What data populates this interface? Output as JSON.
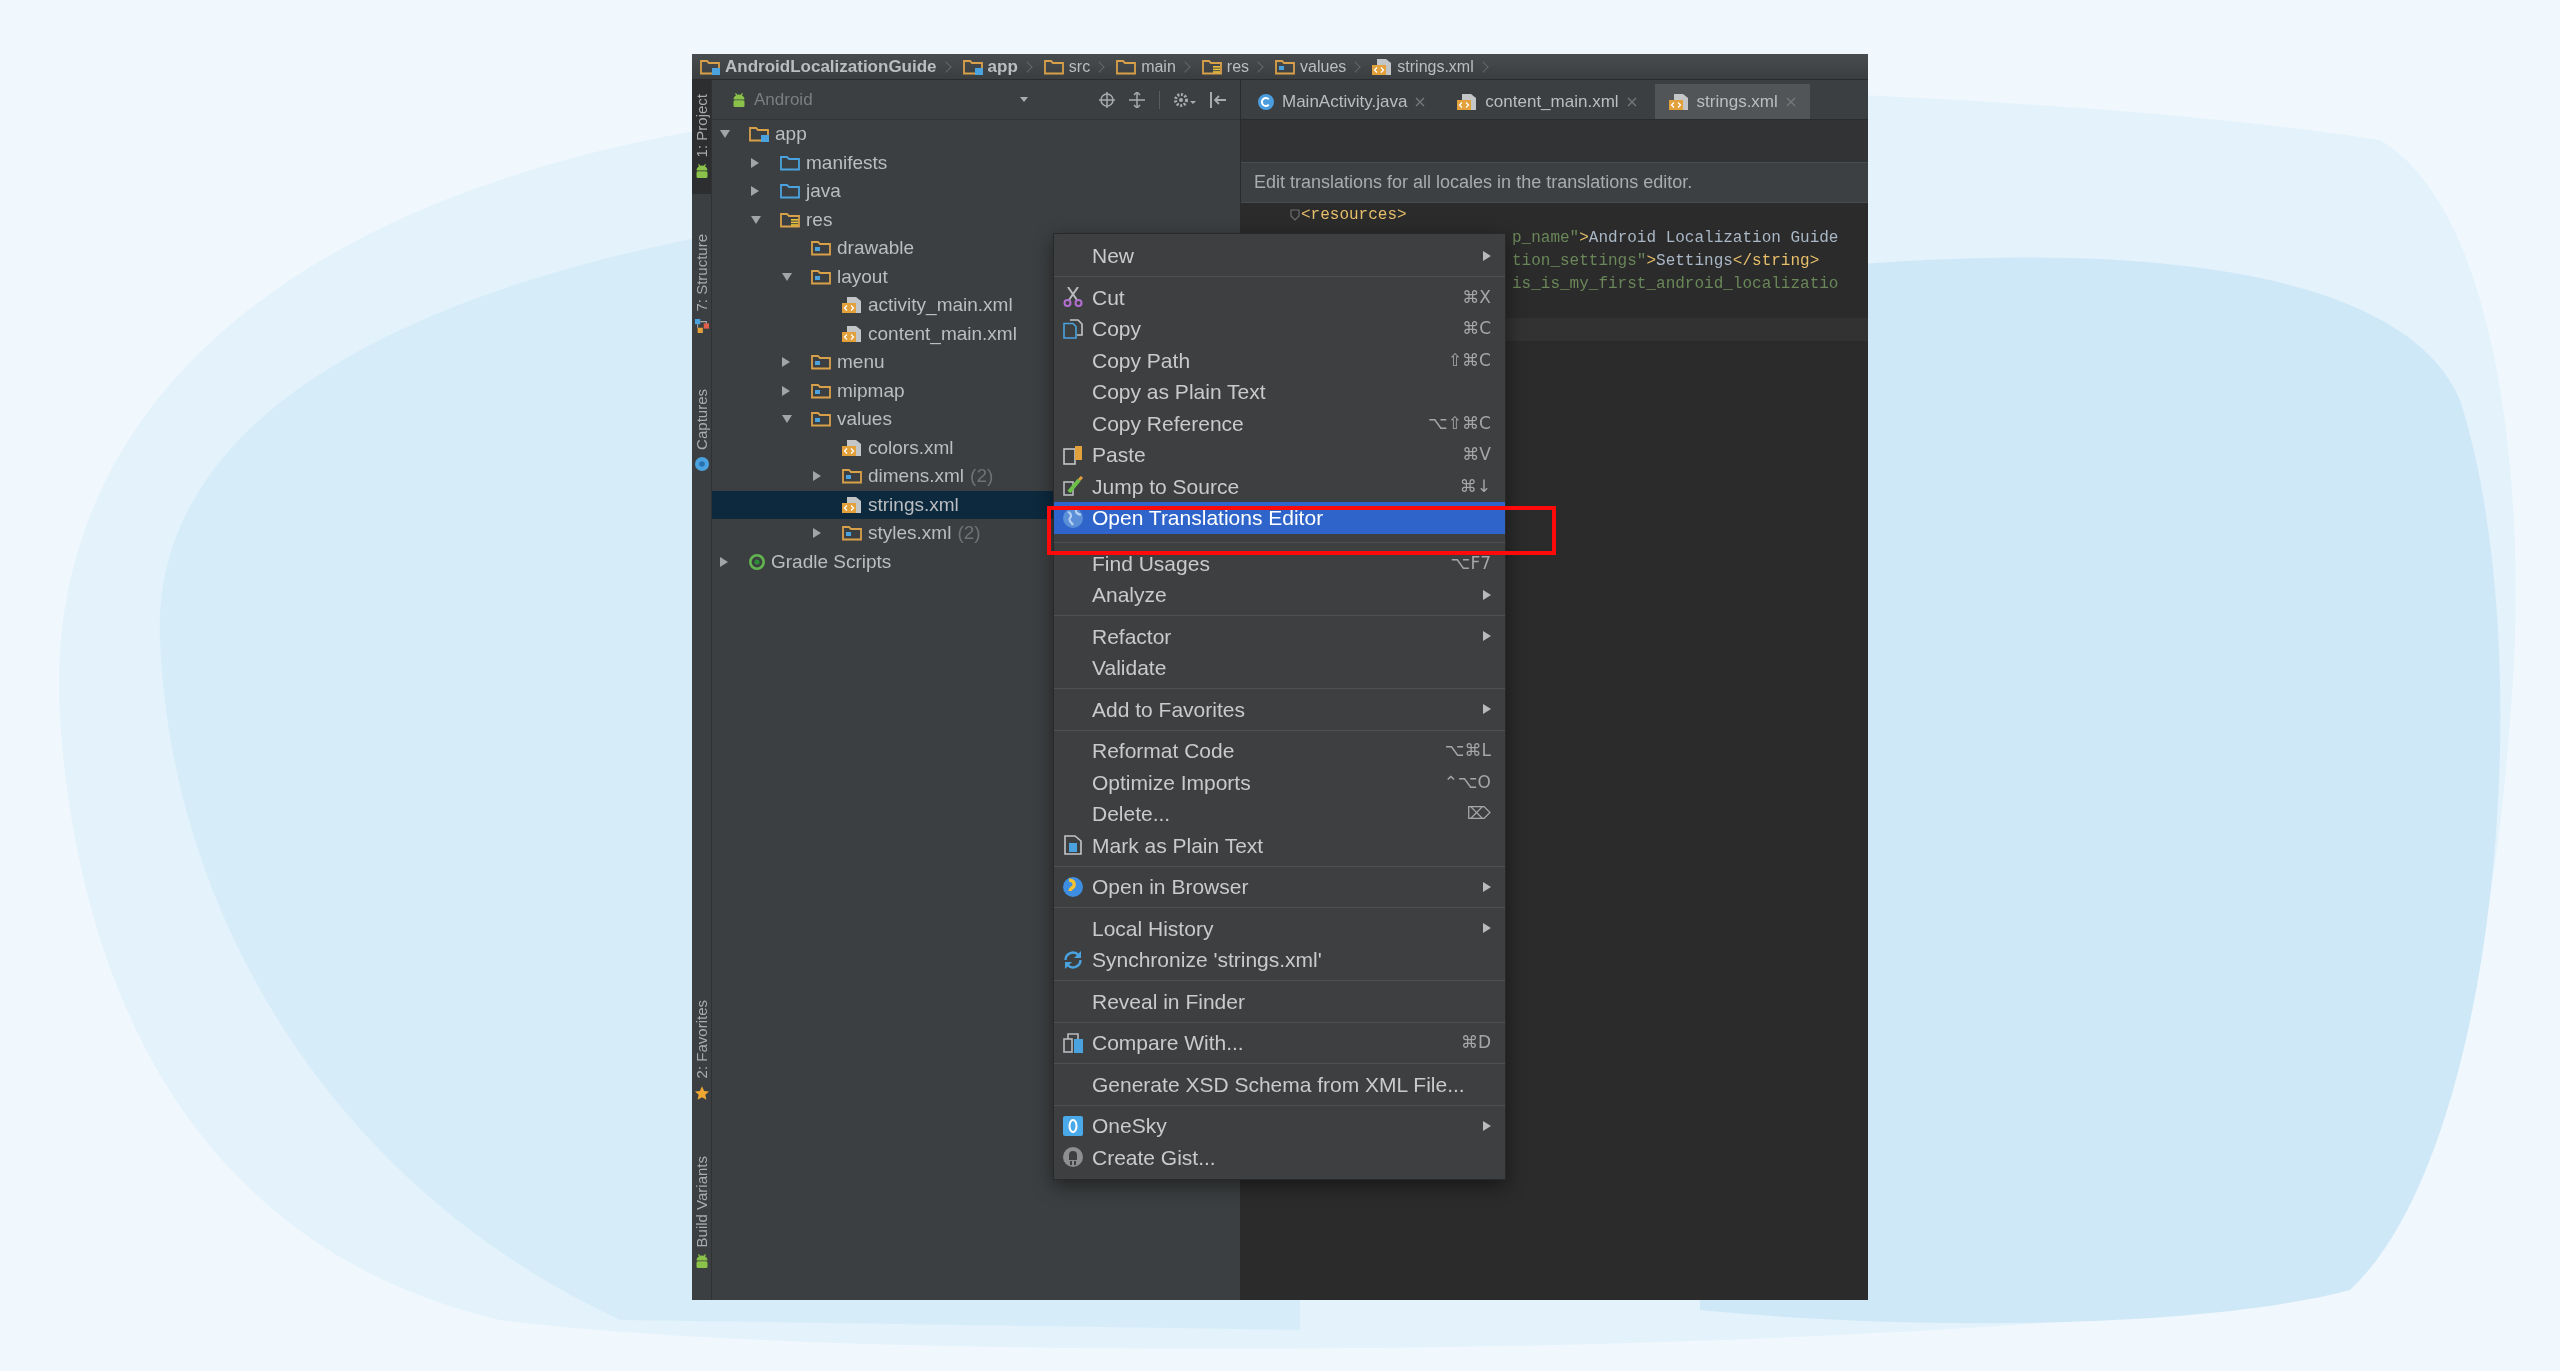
{
  "breadcrumb": [
    {
      "label": "AndroidLocalizationGuide",
      "kind": "module"
    },
    {
      "label": "app",
      "kind": "module"
    },
    {
      "label": "src",
      "kind": "plain-folder"
    },
    {
      "label": "main",
      "kind": "plain-folder"
    },
    {
      "label": "res",
      "kind": "res-folder"
    },
    {
      "label": "values",
      "kind": "folder"
    },
    {
      "label": "strings.xml",
      "kind": "xml-file"
    }
  ],
  "tool_windows": {
    "top": [
      {
        "label": "1: Project",
        "selected": true
      },
      {
        "label": "7: Structure",
        "selected": false
      },
      {
        "label": "Captures",
        "selected": false
      }
    ],
    "bottom": [
      {
        "label": "2: Favorites",
        "selected": false
      },
      {
        "label": "Build Variants",
        "selected": false
      }
    ]
  },
  "project_panel": {
    "view_selector": "Android",
    "tree": [
      {
        "label": "app",
        "kind": "module",
        "expanded": true,
        "selected": false,
        "children": [
          {
            "label": "manifests",
            "kind": "source-folder",
            "expanded": false,
            "selected": false
          },
          {
            "label": "java",
            "kind": "source-folder",
            "expanded": false,
            "selected": false
          },
          {
            "label": "res",
            "kind": "res-folder",
            "expanded": true,
            "selected": false,
            "children": [
              {
                "label": "drawable",
                "kind": "folder",
                "selected": false
              },
              {
                "label": "layout",
                "kind": "folder",
                "expanded": true,
                "selected": false,
                "children": [
                  {
                    "label": "activity_main.xml",
                    "kind": "xml-file",
                    "selected": false
                  },
                  {
                    "label": "content_main.xml",
                    "kind": "xml-file",
                    "selected": false
                  }
                ]
              },
              {
                "label": "menu",
                "kind": "folder",
                "expanded": false,
                "selected": false
              },
              {
                "label": "mipmap",
                "kind": "folder",
                "expanded": false,
                "selected": false
              },
              {
                "label": "values",
                "kind": "folder",
                "expanded": true,
                "selected": false,
                "children": [
                  {
                    "label": "colors.xml",
                    "kind": "xml-file",
                    "selected": false
                  },
                  {
                    "label": "dimens.xml",
                    "count": "(2)",
                    "kind": "xml-group",
                    "expanded": false,
                    "selected": false
                  },
                  {
                    "label": "strings.xml",
                    "kind": "xml-file",
                    "selected": true
                  },
                  {
                    "label": "styles.xml",
                    "count": "(2)",
                    "kind": "xml-group",
                    "expanded": false,
                    "selected": false
                  }
                ]
              }
            ]
          }
        ]
      },
      {
        "label": "Gradle Scripts",
        "kind": "gradle",
        "expanded": false,
        "selected": false
      }
    ]
  },
  "editor": {
    "tabs": [
      {
        "label": "MainActivity.java",
        "kind": "java",
        "selected": false
      },
      {
        "label": "content_main.xml",
        "kind": "xml",
        "selected": false
      },
      {
        "label": "strings.xml",
        "kind": "xml",
        "selected": true
      }
    ],
    "banner": "Edit translations for all locales in the translations editor.",
    "code_lines": [
      {
        "foldable": true,
        "behind_menu": false,
        "segments": [
          {
            "kind": "tag",
            "text": "<resources>"
          }
        ]
      },
      {
        "foldable": false,
        "behind_menu": true,
        "segments": [
          {
            "kind": "attr-value",
            "text": "p_name\""
          },
          {
            "kind": "tag",
            "text": ">"
          },
          {
            "kind": "text",
            "text": "Android Localization Guide"
          }
        ]
      },
      {
        "foldable": false,
        "behind_menu": true,
        "segments": [
          {
            "kind": "attr-value",
            "text": "tion_settings\""
          },
          {
            "kind": "tag",
            "text": ">"
          },
          {
            "kind": "text",
            "text": "Settings"
          },
          {
            "kind": "tag",
            "text": "</string>"
          }
        ]
      },
      {
        "foldable": false,
        "behind_menu": true,
        "segments": [
          {
            "kind": "attr-value",
            "text": "is_is_my_first_android_localizatio"
          }
        ]
      }
    ]
  },
  "context_menu": {
    "items": [
      {
        "kind": "action",
        "label": "New",
        "submenu": true,
        "selected": false
      },
      {
        "kind": "separator"
      },
      {
        "kind": "action",
        "label": "Cut",
        "shortcut": "⌘X",
        "submenu": false,
        "selected": false
      },
      {
        "kind": "action",
        "label": "Copy",
        "shortcut": "⌘C",
        "submenu": false,
        "selected": false
      },
      {
        "kind": "action",
        "label": "Copy Path",
        "shortcut": "⇧⌘C",
        "submenu": false,
        "selected": false
      },
      {
        "kind": "action",
        "label": "Copy as Plain Text",
        "submenu": false,
        "selected": false
      },
      {
        "kind": "action",
        "label": "Copy Reference",
        "shortcut": "⌥⇧⌘C",
        "submenu": false,
        "selected": false
      },
      {
        "kind": "action",
        "label": "Paste",
        "shortcut": "⌘V",
        "submenu": false,
        "selected": false
      },
      {
        "kind": "action",
        "label": "Jump to Source",
        "shortcut": "⌘↓",
        "submenu": false,
        "selected": false
      },
      {
        "kind": "action",
        "label": "Open Translations Editor",
        "submenu": false,
        "selected": true
      },
      {
        "kind": "separator"
      },
      {
        "kind": "action",
        "label": "Find Usages",
        "shortcut": "⌥F7",
        "submenu": false,
        "selected": false
      },
      {
        "kind": "action",
        "label": "Analyze",
        "submenu": true,
        "selected": false
      },
      {
        "kind": "separator"
      },
      {
        "kind": "action",
        "label": "Refactor",
        "submenu": true,
        "selected": false
      },
      {
        "kind": "action",
        "label": "Validate",
        "submenu": false,
        "selected": false
      },
      {
        "kind": "separator"
      },
      {
        "kind": "action",
        "label": "Add to Favorites",
        "submenu": true,
        "selected": false
      },
      {
        "kind": "separator"
      },
      {
        "kind": "action",
        "label": "Reformat Code",
        "shortcut": "⌥⌘L",
        "submenu": false,
        "selected": false
      },
      {
        "kind": "action",
        "label": "Optimize Imports",
        "shortcut": "⌃⌥O",
        "submenu": false,
        "selected": false
      },
      {
        "kind": "action",
        "label": "Delete...",
        "shortcut": "⌦",
        "submenu": false,
        "selected": false
      },
      {
        "kind": "action",
        "label": "Mark as Plain Text",
        "submenu": false,
        "selected": false
      },
      {
        "kind": "separator"
      },
      {
        "kind": "action",
        "label": "Open in Browser",
        "submenu": true,
        "selected": false
      },
      {
        "kind": "separator"
      },
      {
        "kind": "action",
        "label": "Local History",
        "submenu": true,
        "selected": false
      },
      {
        "kind": "action",
        "label": "Synchronize 'strings.xml'",
        "submenu": false,
        "selected": false
      },
      {
        "kind": "separator"
      },
      {
        "kind": "action",
        "label": "Reveal in Finder",
        "submenu": false,
        "selected": false
      },
      {
        "kind": "separator"
      },
      {
        "kind": "action",
        "label": "Compare With...",
        "shortcut": "⌘D",
        "submenu": false,
        "selected": false
      },
      {
        "kind": "separator"
      },
      {
        "kind": "action",
        "label": "Generate XSD Schema from XML File...",
        "submenu": false,
        "selected": false
      },
      {
        "kind": "separator"
      },
      {
        "kind": "action",
        "label": "OneSky",
        "submenu": true,
        "selected": false
      },
      {
        "kind": "action",
        "label": "Create Gist...",
        "submenu": false,
        "selected": false
      }
    ]
  }
}
